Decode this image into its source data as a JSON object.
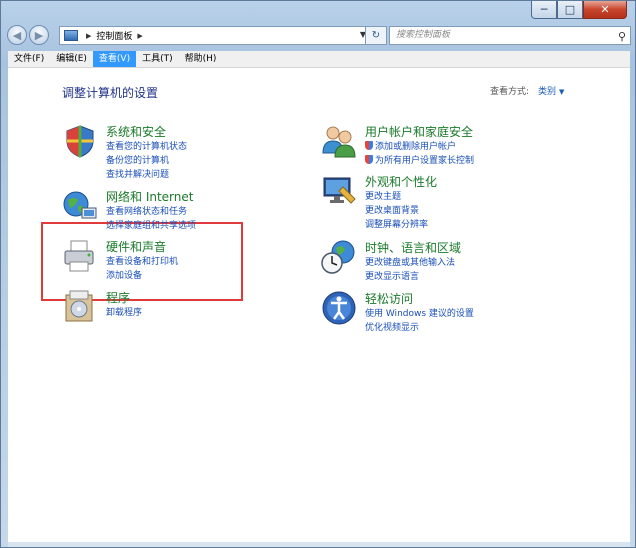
{
  "window": {
    "minimize_glyph": "─",
    "maximize_glyph": "□",
    "close_glyph": "✕"
  },
  "nav": {
    "back_glyph": "◀",
    "forward_glyph": "▶",
    "breadcrumb": "控制面板",
    "search_placeholder": "搜索控制面板",
    "refresh_glyph": "↻"
  },
  "menu": [
    "文件(F)",
    "编辑(E)",
    "查看(V)",
    "工具(T)",
    "帮助(H)"
  ],
  "menu_active_index": 2,
  "main": {
    "title": "调整计算机的设置",
    "view_by_label": "查看方式:",
    "view_by_value": "类别"
  },
  "categories": [
    {
      "name": "system-security",
      "title": "系统和安全",
      "links": [
        "查看您的计算机状态",
        "备份您的计算机",
        "查找并解决问题"
      ],
      "icon": "shield-icon"
    },
    {
      "name": "network-internet",
      "title": "网络和 Internet",
      "links": [
        "查看网络状态和任务",
        "选择家庭组和共享选项"
      ],
      "icon": "globe-network-icon"
    },
    {
      "name": "hardware-sound",
      "title": "硬件和声音",
      "links": [
        "查看设备和打印机",
        "添加设备"
      ],
      "icon": "printer-icon"
    },
    {
      "name": "programs",
      "title": "程序",
      "links": [
        "卸载程序"
      ],
      "icon": "programs-icon"
    },
    {
      "name": "user-accounts",
      "title": "用户帐户和家庭安全",
      "links": [
        "添加或删除用户帐户",
        "为所有用户设置家长控制"
      ],
      "icon": "users-icon",
      "link_shields": [
        true,
        true
      ]
    },
    {
      "name": "appearance",
      "title": "外观和个性化",
      "links": [
        "更改主题",
        "更改桌面背景",
        "调整屏幕分辨率"
      ],
      "icon": "display-icon"
    },
    {
      "name": "clock-language",
      "title": "时钟、语言和区域",
      "links": [
        "更改键盘或其他输入法",
        "更改显示语言"
      ],
      "icon": "clock-globe-icon"
    },
    {
      "name": "ease-of-access",
      "title": "轻松访问",
      "links": [
        "使用 Windows 建议的设置",
        "优化视频显示"
      ],
      "icon": "ease-access-icon"
    }
  ],
  "colors": {
    "category_title": "#1a7a2a",
    "link": "#1a4fb8",
    "highlight": "#e03a3a",
    "menu_active": "#3399ff"
  }
}
